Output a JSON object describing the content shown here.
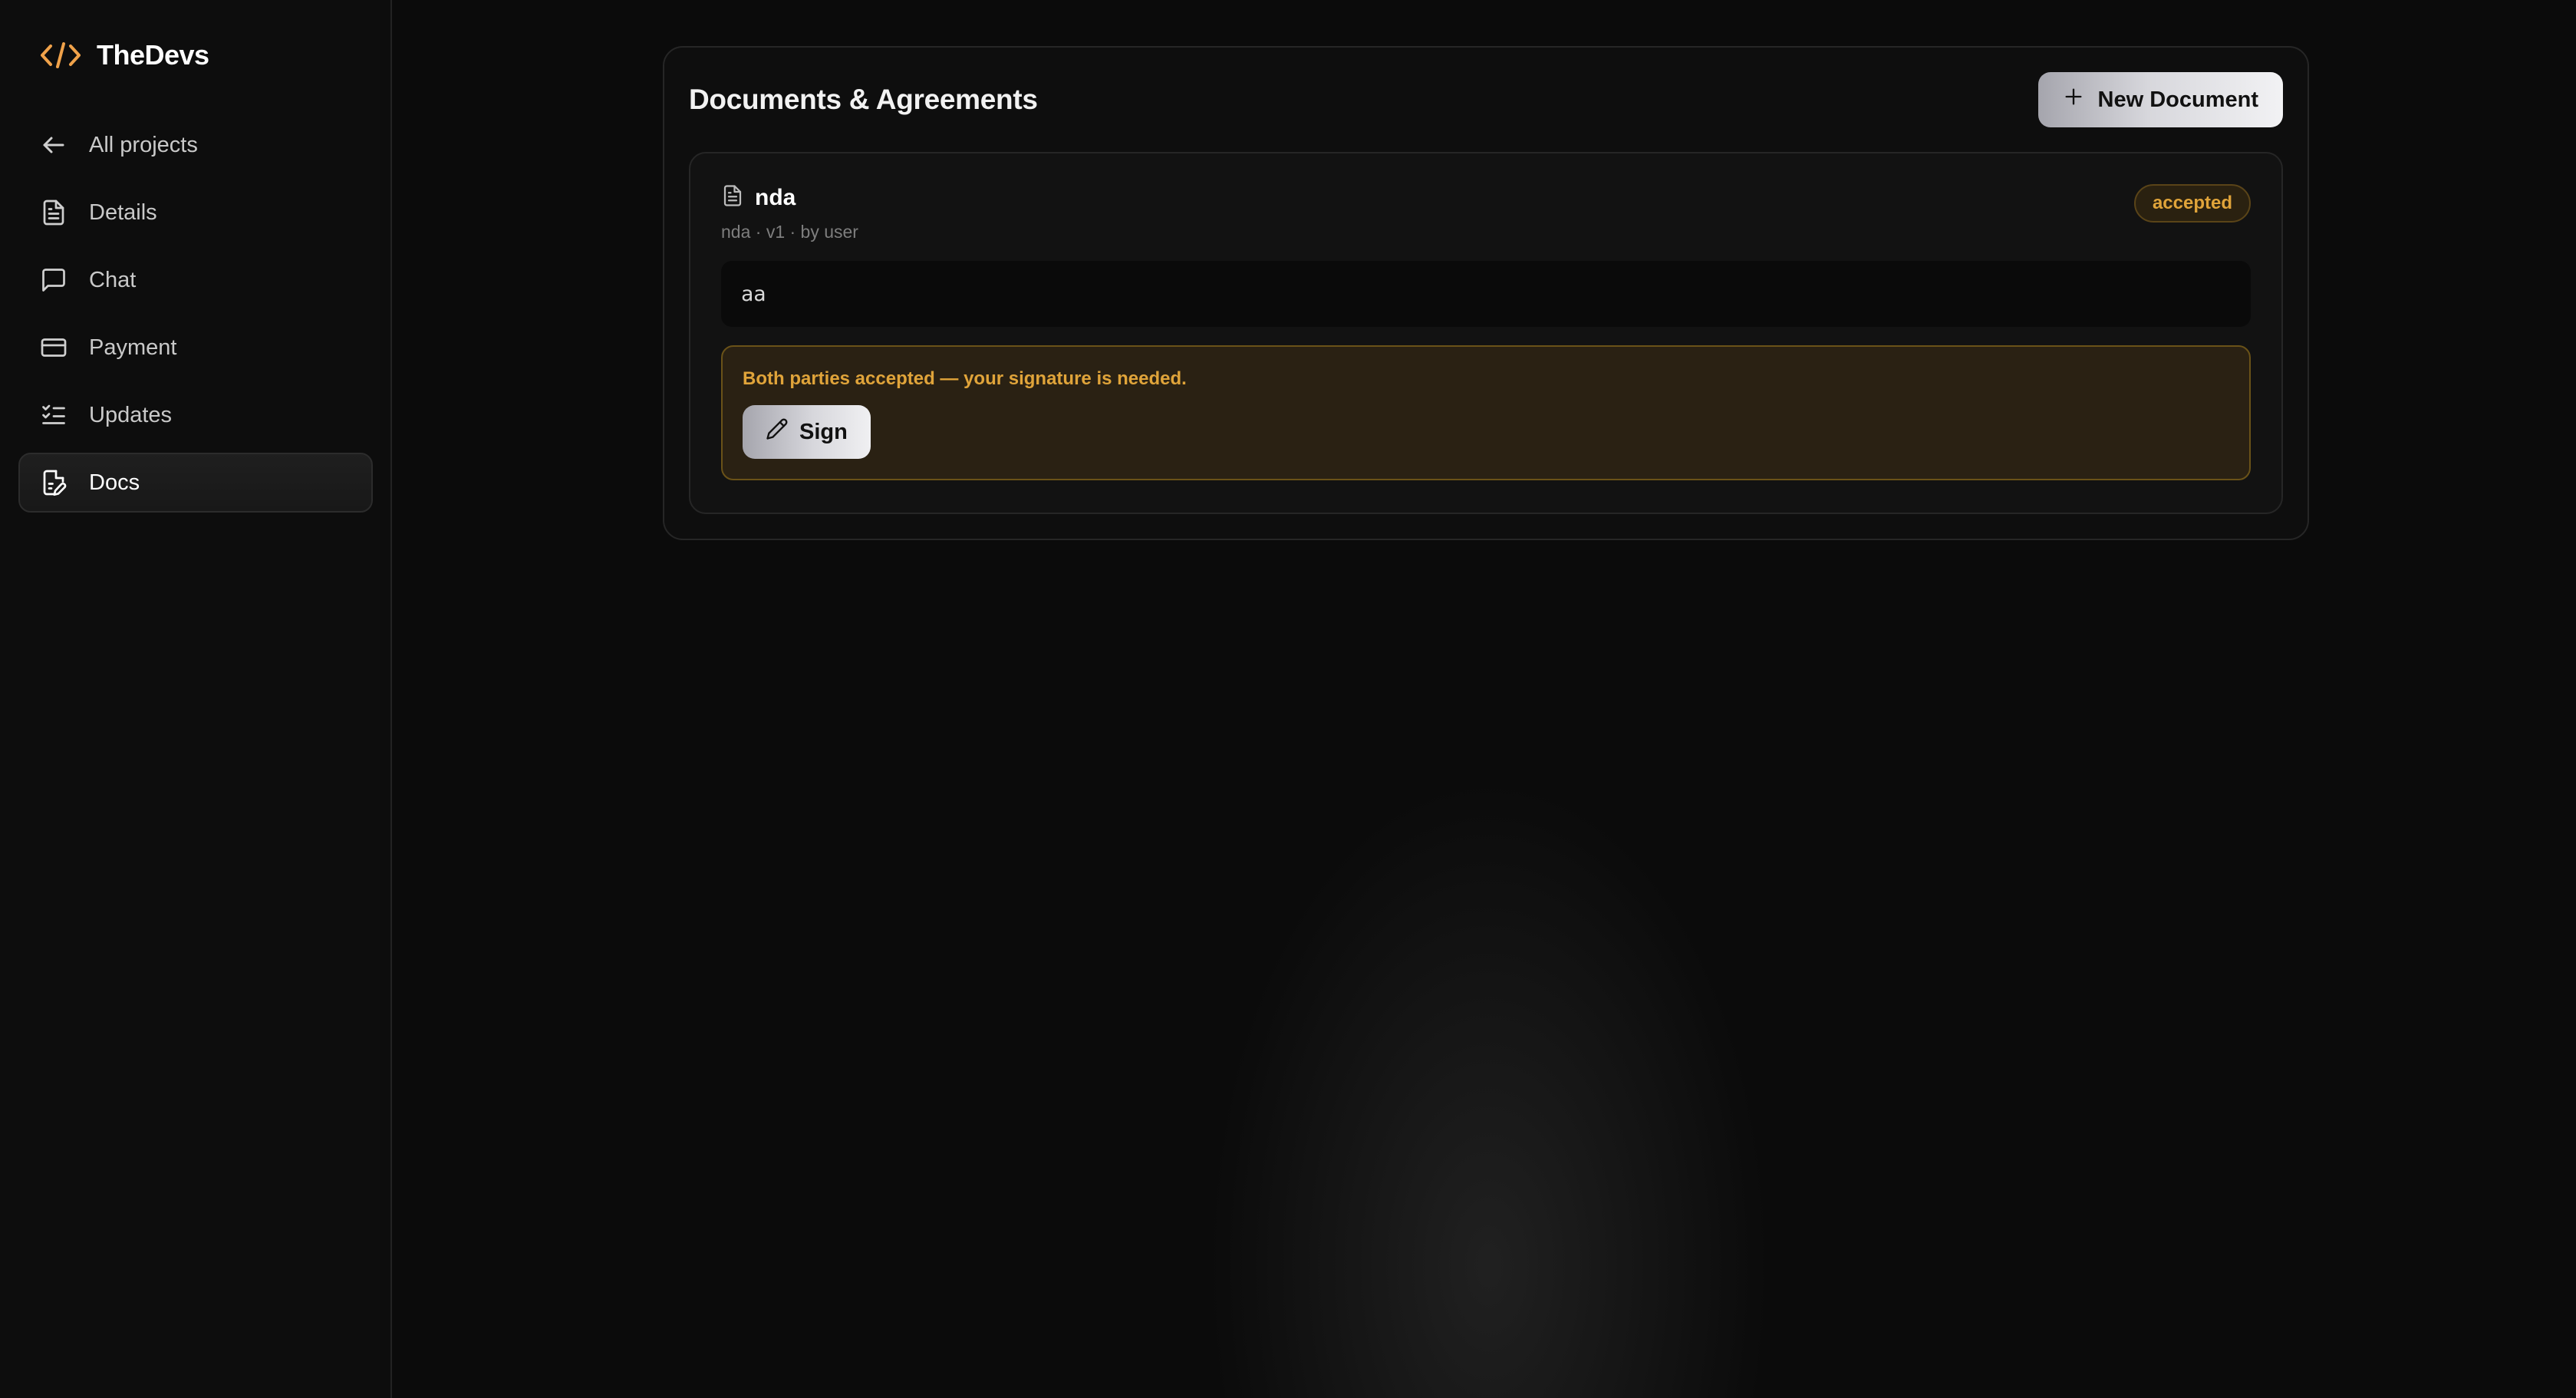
{
  "brand": {
    "name": "TheDevs",
    "logo_icon": "code-brackets-icon",
    "accent_color": "#f0a24a"
  },
  "sidebar": {
    "items": [
      {
        "label": "All projects",
        "icon": "arrow-left-icon",
        "active": false
      },
      {
        "label": "Details",
        "icon": "file-text-icon",
        "active": false
      },
      {
        "label": "Chat",
        "icon": "message-square-icon",
        "active": false
      },
      {
        "label": "Payment",
        "icon": "credit-card-icon",
        "active": false
      },
      {
        "label": "Updates",
        "icon": "list-checks-icon",
        "active": false
      },
      {
        "label": "Docs",
        "icon": "file-signature-icon",
        "active": true
      }
    ]
  },
  "main": {
    "title": "Documents & Agreements",
    "new_document_label": "New Document",
    "documents": [
      {
        "title": "nda",
        "meta": "nda · v1 · by user",
        "status": "accepted",
        "content": "aa",
        "notice": "Both parties accepted — your signature is needed.",
        "sign_label": "Sign"
      }
    ]
  },
  "colors": {
    "warning_text": "#e0a43a",
    "warning_bg": "#2a2113",
    "background": "#0b0b0b"
  }
}
